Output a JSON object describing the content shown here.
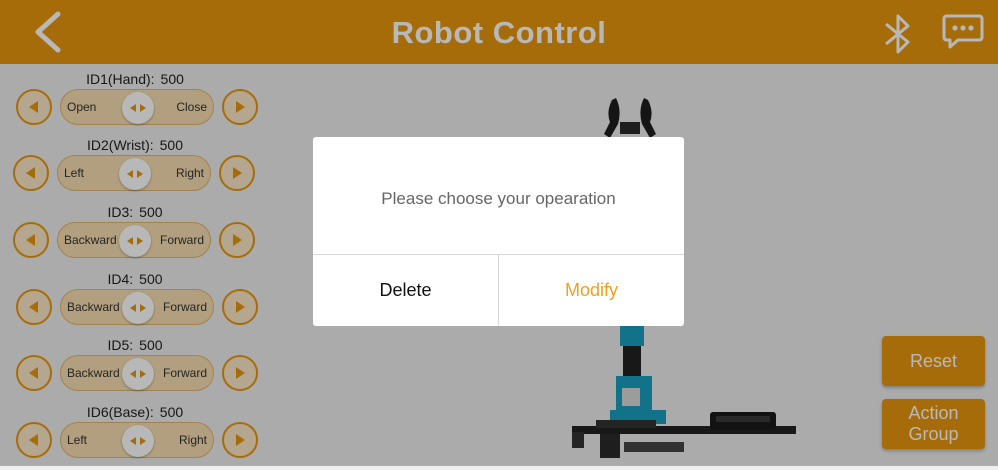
{
  "header": {
    "title": "Robot Control"
  },
  "servos": [
    {
      "name": "ID1(Hand):",
      "value": "500",
      "left": "Open",
      "right": "Close"
    },
    {
      "name": "ID2(Wrist):",
      "value": "500",
      "left": "Left",
      "right": "Right"
    },
    {
      "name": "ID3:",
      "value": "500",
      "left": "Backward",
      "right": "Forward"
    },
    {
      "name": "ID4:",
      "value": "500",
      "left": "Backward",
      "right": "Forward"
    },
    {
      "name": "ID5:",
      "value": "500",
      "left": "Backward",
      "right": "Forward"
    },
    {
      "name": "ID6(Base):",
      "value": "500",
      "left": "Left",
      "right": "Right"
    }
  ],
  "actions": {
    "reset": "Reset",
    "action_group": "Action\nGroup"
  },
  "dialog": {
    "message": "Please choose your opearation",
    "delete": "Delete",
    "modify": "Modify"
  },
  "colors": {
    "accent": "#E8960E",
    "dialog_accent": "#F0A020"
  },
  "icons": [
    "back-arrow-icon",
    "bluetooth-icon",
    "chat-bubble-icon",
    "left-triangle-icon",
    "right-triangle-icon",
    "left-right-arrows-icon"
  ]
}
